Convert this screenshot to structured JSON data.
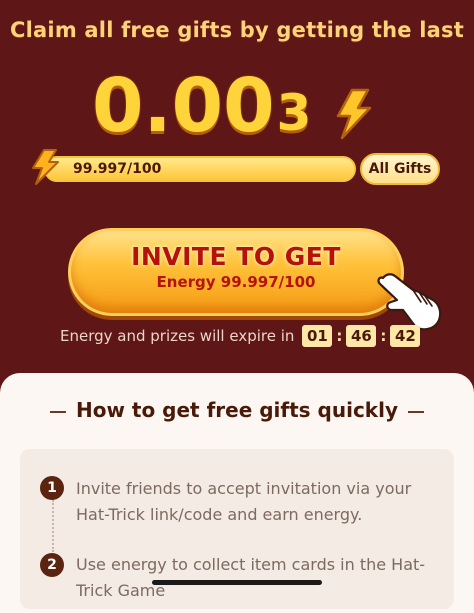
{
  "header": {
    "headline": "Claim all free gifts by getting the last",
    "energy_main": "0.00",
    "energy_tail": "3"
  },
  "progress": {
    "text": "99.997/100",
    "fraction": 0.99997
  },
  "all_gifts_label": "All Gifts",
  "invite": {
    "title": "INVITE TO GET",
    "subtitle": "Energy 99.997/100"
  },
  "expire": {
    "label": "Energy and prizes will expire in",
    "hours": "01",
    "minutes": "46",
    "seconds": "42"
  },
  "guide": {
    "title": "How to get free gifts quickly",
    "steps": [
      {
        "num": "1",
        "text": "Invite friends to accept invitation via your Hat-Trick link/code and earn energy."
      },
      {
        "num": "2",
        "text": "Use energy to collect item cards in the Hat-Trick Game"
      }
    ]
  },
  "icons": {
    "bolt": "lightning-bolt-icon",
    "hand": "pointing-hand-icon"
  },
  "colors": {
    "background": "#5e1616",
    "gold": "#ffd43a",
    "button_text": "#b5120a"
  }
}
